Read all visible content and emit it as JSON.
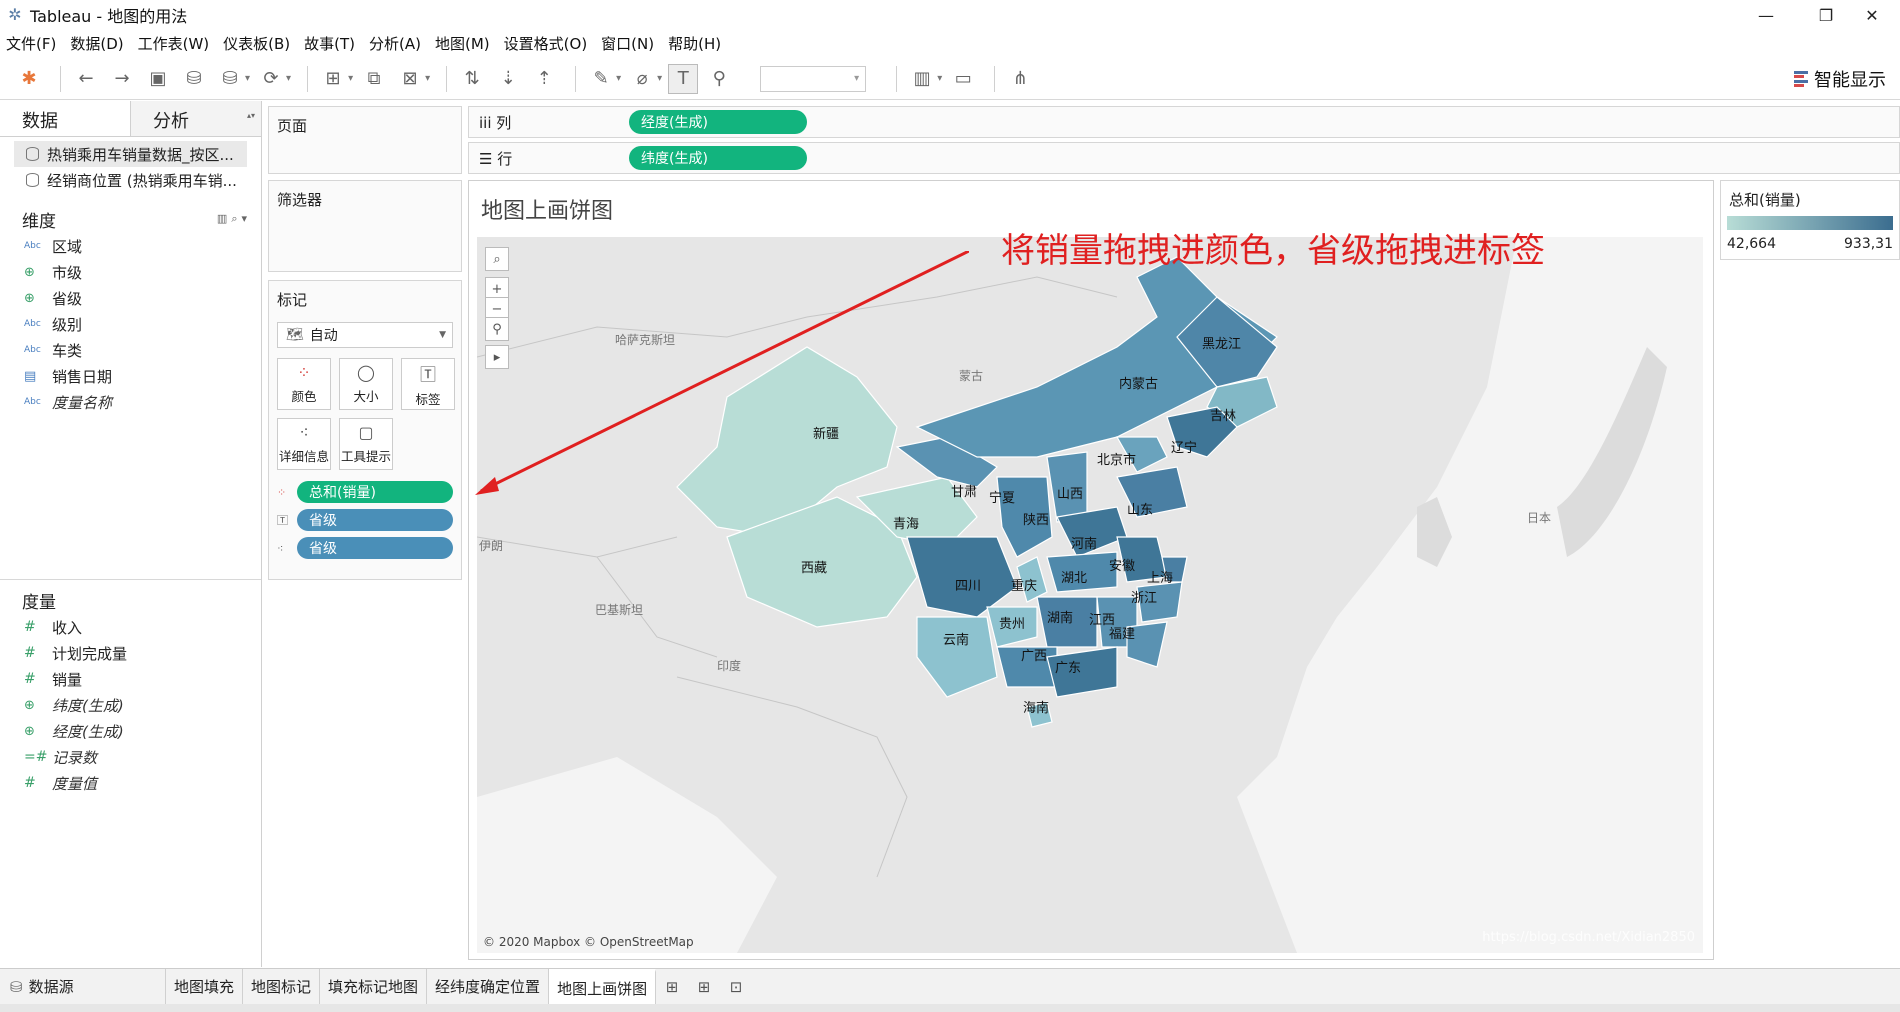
{
  "window": {
    "title": "Tableau - 地图的用法",
    "controls": {
      "minimize": "—",
      "maximize": "❐",
      "close": "✕"
    }
  },
  "menu": [
    "文件(F)",
    "数据(D)",
    "工作表(W)",
    "仪表板(B)",
    "故事(T)",
    "分析(A)",
    "地图(M)",
    "设置格式(O)",
    "窗口(N)",
    "帮助(H)"
  ],
  "toolbar": {
    "smart_show": "智能显示"
  },
  "left_panel": {
    "tabs": {
      "data": "数据",
      "analysis": "分析"
    },
    "datasources": [
      "热销乘用车销量数据_按区...",
      "经销商位置 (热销乘用车销..."
    ],
    "dimensions_title": "维度",
    "dimensions": [
      {
        "type": "Abc",
        "name": "区域"
      },
      {
        "type": "globe",
        "name": "市级"
      },
      {
        "type": "globe",
        "name": "省级"
      },
      {
        "type": "Abc",
        "name": "级别"
      },
      {
        "type": "Abc",
        "name": "车类"
      },
      {
        "type": "date",
        "name": "销售日期"
      },
      {
        "type": "Abc",
        "name": "度量名称"
      }
    ],
    "measures_title": "度量",
    "measures": [
      {
        "type": "#",
        "name": "收入"
      },
      {
        "type": "#",
        "name": "计划完成量"
      },
      {
        "type": "#",
        "name": "销量"
      },
      {
        "type": "globe",
        "name": "纬度(生成)"
      },
      {
        "type": "globe",
        "name": "经度(生成)"
      },
      {
        "type": "#",
        "name": "记录数"
      },
      {
        "type": "#",
        "name": "度量值"
      }
    ]
  },
  "shelves": {
    "pages": "页面",
    "filters": "筛选器",
    "marks": "标记",
    "marks_type": "自动",
    "mark_buttons": [
      "颜色",
      "大小",
      "标签",
      "详细信息",
      "工具提示"
    ],
    "mark_pills": [
      "总和(销量)",
      "省级",
      "省级"
    ],
    "columns_label": "iii  列",
    "rows_label": "☰  行",
    "columns_pill": "经度(生成)",
    "rows_pill": "纬度(生成)"
  },
  "view": {
    "title": "地图上画饼图",
    "annotation": "将销量拖拽进颜色，省级拖拽进标签",
    "copyright": "© 2020 Mapbox © OpenStreetMap",
    "watermark": "https://blog.csdn.net/Xidian2850",
    "map_labels_bg": [
      "哈萨克斯坦",
      "蒙古",
      "日本",
      "巴基斯坦",
      "印度",
      "伊朗"
    ],
    "provinces": [
      "黑龙江",
      "内蒙古",
      "吉林",
      "辽宁",
      "北京市",
      "新疆",
      "甘肃",
      "宁夏",
      "山西",
      "山东",
      "陕西",
      "河南",
      "青海",
      "西藏",
      "四川",
      "重庆",
      "湖北",
      "安徽",
      "上海",
      "浙江",
      "湖南",
      "江西",
      "贵州",
      "福建",
      "云南",
      "广西",
      "广东",
      "海南"
    ]
  },
  "legend": {
    "title": "总和(销量)",
    "min": "42,664",
    "max": "933,31"
  },
  "bottom_tabs": [
    "数据源",
    "地图填充",
    "地图标记",
    "填充标记地图",
    "经纬度确定位置",
    "地图上画饼图"
  ],
  "colors": {
    "accent_green": "#12b47e",
    "pill_blue": "#4a8fb8",
    "annotation_red": "#e02020"
  }
}
